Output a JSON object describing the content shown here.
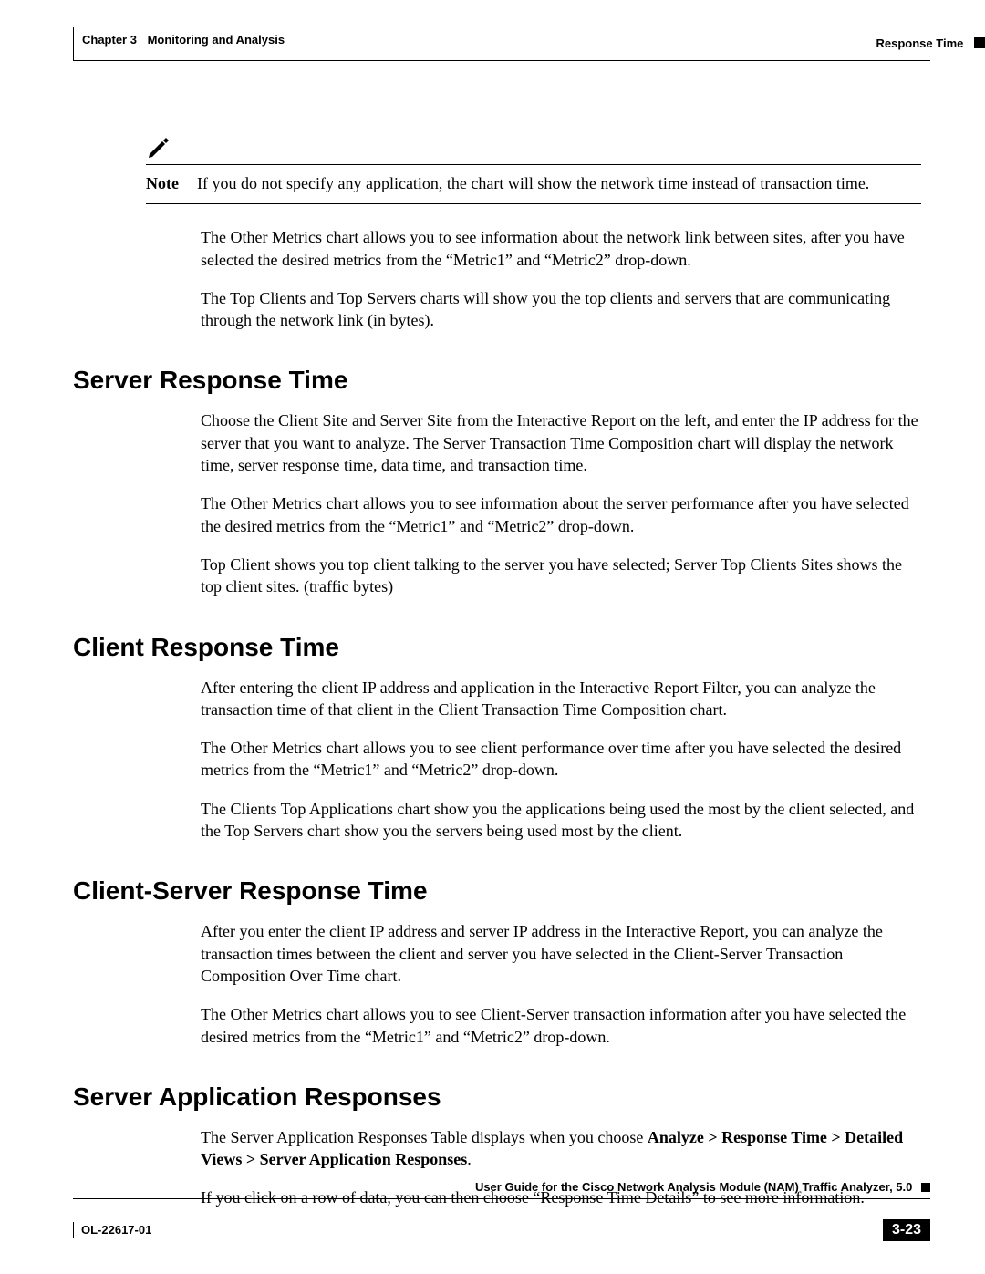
{
  "header": {
    "chapter_num": "Chapter 3",
    "chapter_title": "Monitoring and Analysis",
    "section_right": "Response Time"
  },
  "note": {
    "label": "Note",
    "text": "If you do not specify any application, the chart will show the network time instead of transaction time."
  },
  "intro": {
    "p1": "The Other Metrics chart allows you to see information about the network link between sites, after you have selected the desired metrics from the “Metric1” and “Metric2” drop-down.",
    "p2": "The Top Clients and Top Servers charts will show you the top clients and servers that are communicating through the network link (in bytes)."
  },
  "sections": {
    "server_response": {
      "heading": "Server Response Time",
      "p1": "Choose the Client Site and Server Site from the Interactive Report on the left, and enter the IP address for the server that you want to analyze. The Server Transaction Time Composition chart will display the network time, server response time, data time, and transaction time.",
      "p2": "The Other Metrics chart allows you to see information about the server performance after you have selected the desired metrics from the “Metric1” and “Metric2” drop-down.",
      "p3": "Top Client shows you top client talking to the server you have selected; Server Top Clients Sites shows the top client sites. (traffic bytes)"
    },
    "client_response": {
      "heading": "Client Response Time",
      "p1": "After entering the client IP address and application in the Interactive Report Filter, you can analyze the transaction time of that client in the Client Transaction Time Composition chart.",
      "p2": "The Other Metrics chart allows you to see client performance over time after you have selected the desired metrics from the “Metric1” and “Metric2” drop-down.",
      "p3": "The Clients Top Applications chart show you the applications being used the most by the client selected, and the Top Servers chart show you the servers being used most by the client."
    },
    "client_server_response": {
      "heading": "Client-Server Response Time",
      "p1": "After you enter the client IP address and server IP address in the Interactive Report, you can analyze the transaction times between the client and server you have selected in the Client-Server Transaction Composition Over Time chart.",
      "p2": "The Other Metrics chart allows you to see Client-Server transaction information after you have selected the desired metrics from the “Metric1” and “Metric2” drop-down."
    },
    "server_app_responses": {
      "heading": "Server Application Responses",
      "p1_pre": "The Server Application Responses Table displays when you choose ",
      "p1_bold": "Analyze > Response Time > Detailed Views > Server Application Responses",
      "p1_post": ".",
      "p2": "If you click on a row of data, you can then choose “Response Time Details” to see more information."
    }
  },
  "footer": {
    "guide_title": "User Guide for the Cisco Network Analysis Module (NAM) Traffic Analyzer, 5.0",
    "doc_id": "OL-22617-01",
    "page_num": "3-23"
  }
}
